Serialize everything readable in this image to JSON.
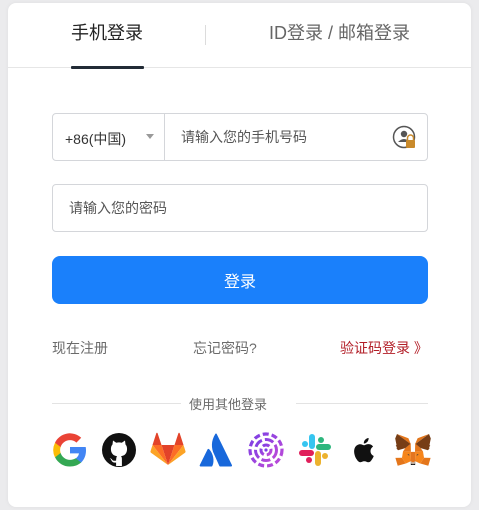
{
  "tabs": [
    {
      "label": "手机登录",
      "active": true
    },
    {
      "label": "ID登录 / 邮箱登录",
      "active": false
    }
  ],
  "phone": {
    "country_code": "+86(中国)",
    "placeholder": "请输入您的手机号码"
  },
  "password": {
    "placeholder": "请输入您的密码"
  },
  "login_button": "登录",
  "links": {
    "register": "现在注册",
    "forgot": "忘记密码?",
    "code_login": "验证码登录 》"
  },
  "other_login_label": "使用其他登录",
  "social_logins": [
    {
      "icon": "google-icon"
    },
    {
      "icon": "github-icon"
    },
    {
      "icon": "gitlab-icon"
    },
    {
      "icon": "atlassian-icon"
    },
    {
      "icon": "spiral-logo-icon"
    },
    {
      "icon": "slack-icon"
    },
    {
      "icon": "apple-icon"
    },
    {
      "icon": "metamask-icon"
    }
  ],
  "colors": {
    "primary": "#1a80fb",
    "code_link": "#b21e27",
    "active_tab_underline": "#222b36"
  }
}
